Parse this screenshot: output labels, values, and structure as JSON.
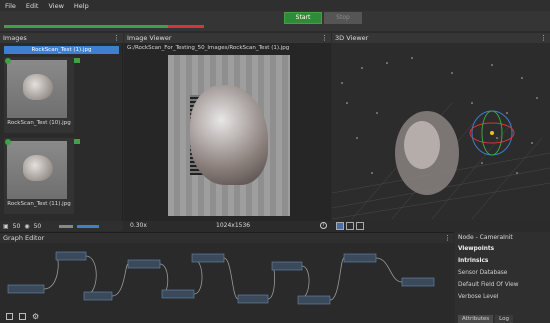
{
  "menu": [
    "File",
    "Edit",
    "View",
    "Help"
  ],
  "toolbar": {
    "start_label": "Start",
    "stop_label": "Stop",
    "progress": 1.0,
    "accent": "#3fa246",
    "error": "#d9343c"
  },
  "images": {
    "title": "Images",
    "selected_label": "RockScan_Test (1).jpg",
    "thumbnails": [
      {
        "label": "RockScan_Test (10).jpg"
      },
      {
        "label": "RockScan_Test (11).jpg"
      }
    ],
    "footer_count_a": "50",
    "footer_count_b": "50"
  },
  "image_viewer": {
    "title": "Image Viewer",
    "path": "G:/RockScan_For_Testing_50_Images/RockScan_Test (1).jpg",
    "zoom": "0.30x",
    "resolution": "1024x1536"
  },
  "viewer3d": {
    "title": "3D Viewer"
  },
  "graph_editor": {
    "title": "Graph Editor"
  },
  "inspector": {
    "node_title": "Node - CameraInit",
    "rows": [
      "Viewpoints",
      "Intrinsics",
      "Sensor Database",
      "Default Field Of View",
      "Verbose Level"
    ],
    "tabs": [
      "Attributes",
      "Log"
    ]
  },
  "icons": [
    "kebab-menu-icon",
    "info-icon",
    "image-icon",
    "camera-icon",
    "mode-buttons",
    "fit-view-icon",
    "fullscreen-icon",
    "settings-icon"
  ]
}
